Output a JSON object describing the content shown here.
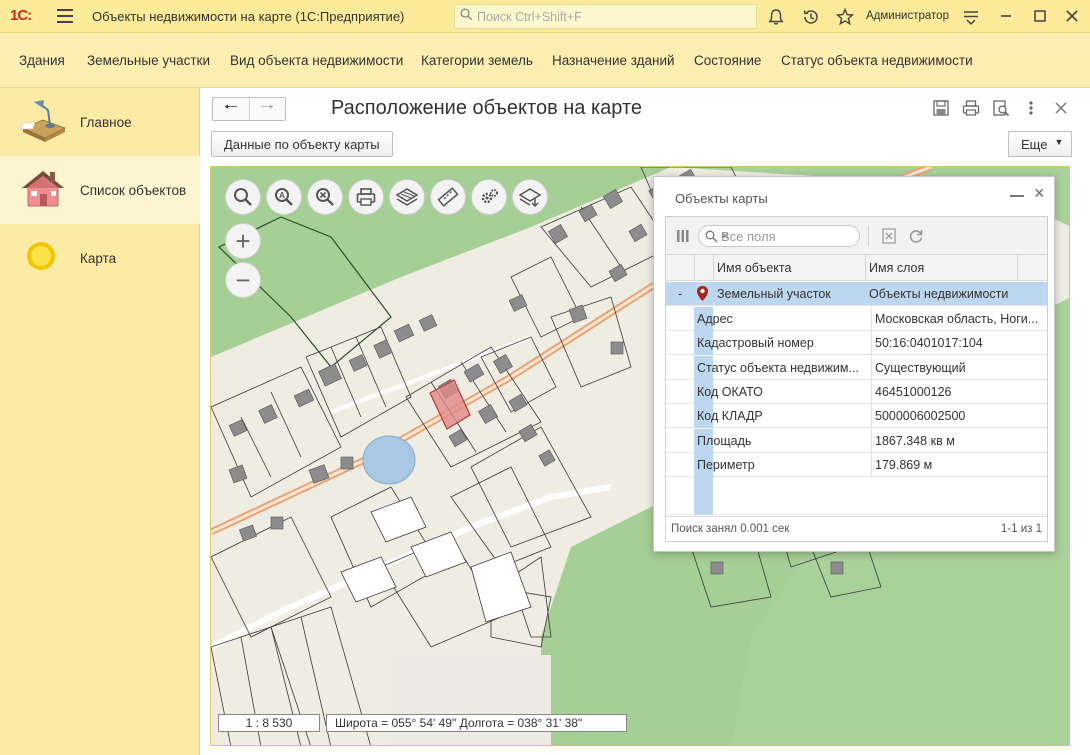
{
  "app": {
    "logo": "1С:",
    "title": "Объекты недвижимости на карте  (1С:Предприятие)",
    "search_placeholder": "Поиск Ctrl+Shift+F",
    "user": "Администратор"
  },
  "topnav": [
    "Здания",
    "Земельные участки",
    "Вид объекта недвижимости",
    "Категории земель",
    "Назначение зданий",
    "Состояние",
    "Статус объекта недвижимости"
  ],
  "sidebar": [
    {
      "label": "Главное",
      "icon": "desk-lamp-icon"
    },
    {
      "label": "Список объектов",
      "icon": "house-icon"
    },
    {
      "label": "Карта",
      "icon": "sun-icon"
    }
  ],
  "form": {
    "title": "Расположение объектов на карте",
    "data_button": "Данные по объекту карты",
    "more_button": "Еще"
  },
  "map": {
    "scale": "1 : 8 530",
    "coords": "Широта = 055° 54' 49\" Долгота = 038° 31' 38\""
  },
  "popup": {
    "title": "Объекты карты",
    "search_placeholder": "Все поля",
    "col_object": "Имя объекта",
    "col_layer": "Имя слоя",
    "expander": "-",
    "object_name": "Земельный участок",
    "layer_name": "Объекты недвижимости",
    "props": [
      {
        "name": "Адрес",
        "value": "Московская область, Ноги..."
      },
      {
        "name": "Кадастровый номер",
        "value": "50:16:0401017:104"
      },
      {
        "name": "Статус объекта недвижим...",
        "value": "Существующий"
      },
      {
        "name": "Код ОКАТО",
        "value": "46451000126"
      },
      {
        "name": "Код КЛАДР",
        "value": "5000006002500"
      },
      {
        "name": "Площадь",
        "value": "1867.348 кв м"
      },
      {
        "name": "Периметр",
        "value": "179.869 м"
      }
    ],
    "status": "Поиск занял 0.001 сек",
    "count": "1-1 из 1"
  }
}
